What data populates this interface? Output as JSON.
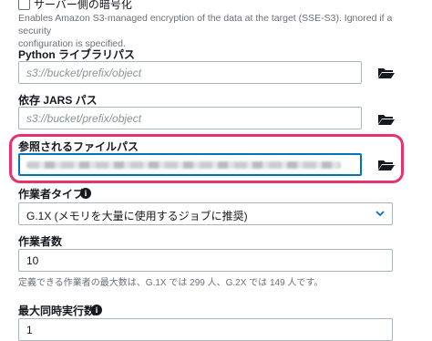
{
  "encryption": {
    "checkbox_label": "サーバー側の暗号化",
    "description_line1": "Enables Amazon S3-managed encryption of the data at the target (SSE-S3). Ignored if a security",
    "description_line2": "configuration is specified."
  },
  "python_library_path": {
    "label": "Python ライブラリパス",
    "placeholder": "s3://bucket/prefix/object",
    "browse_icon": "folder-open-icon"
  },
  "dependent_jars_path": {
    "label": "依存 JARS パス",
    "placeholder": "s3://bucket/prefix/object",
    "browse_icon": "folder-open-icon"
  },
  "referenced_files_path": {
    "label": "参照されるファイルパス",
    "value_obscured": true,
    "browse_icon": "folder-open-icon",
    "highlight_color": "#e8326f"
  },
  "worker_type": {
    "label": "作業者タイプ",
    "info_icon": "info-icon",
    "selected": "G.1X (メモリを大量に使用するジョブに推奨)",
    "dropdown_icon": "chevron-down-icon"
  },
  "number_of_workers": {
    "label": "作業者数",
    "value": "10",
    "hint": "定義できる作業者の最大数は、G.1X では 299 人、G.2X では 149 人です。"
  },
  "max_concurrency": {
    "label": "最大同時実行数",
    "info_icon": "info-icon",
    "value": "1"
  },
  "colors": {
    "accent_blue": "#0073bb",
    "text": "#16191f",
    "muted": "#687078"
  }
}
